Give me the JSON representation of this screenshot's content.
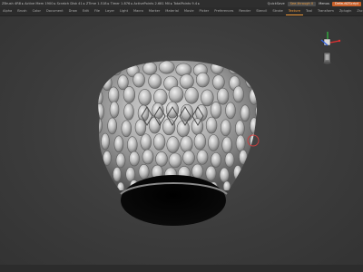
{
  "titlebar": {
    "info": "ZBrush 4R8 ▸ Active Mem 1900 ▸ Scratch Disk 41 ▸ ZTime 1.518 ▸ Timer 1.876 ▸ ActivePoints 2.681 Mil ▸ TotalPoints 9.4 ▸",
    "quicksave": "QuickSave",
    "see_through": "See-through 0",
    "menus_label": "Menus",
    "default_zscript": "DefaultZScript"
  },
  "menu": {
    "items": [
      "Alpha",
      "Brush",
      "Color",
      "Document",
      "Draw",
      "Edit",
      "File",
      "Layer",
      "Light",
      "Macro",
      "Marker",
      "Material",
      "Movie",
      "Picker",
      "Preferences",
      "Render",
      "Stencil",
      "Stroke",
      "Texture",
      "Tool",
      "Transform",
      "Zplugin",
      "Zscript",
      "Help"
    ],
    "active_index": 18
  },
  "bottombar": {
    "text": ""
  },
  "colors": {
    "accent": "#f29a3a",
    "gizmo_x": "#e03030",
    "gizmo_y": "#30c040",
    "gizmo_z": "#3060e0",
    "cursor_ring": "#c84040"
  },
  "icons": {
    "axis_gizmo": "axis-gizmo-icon",
    "brush_cursor": "brush-cursor-icon"
  }
}
